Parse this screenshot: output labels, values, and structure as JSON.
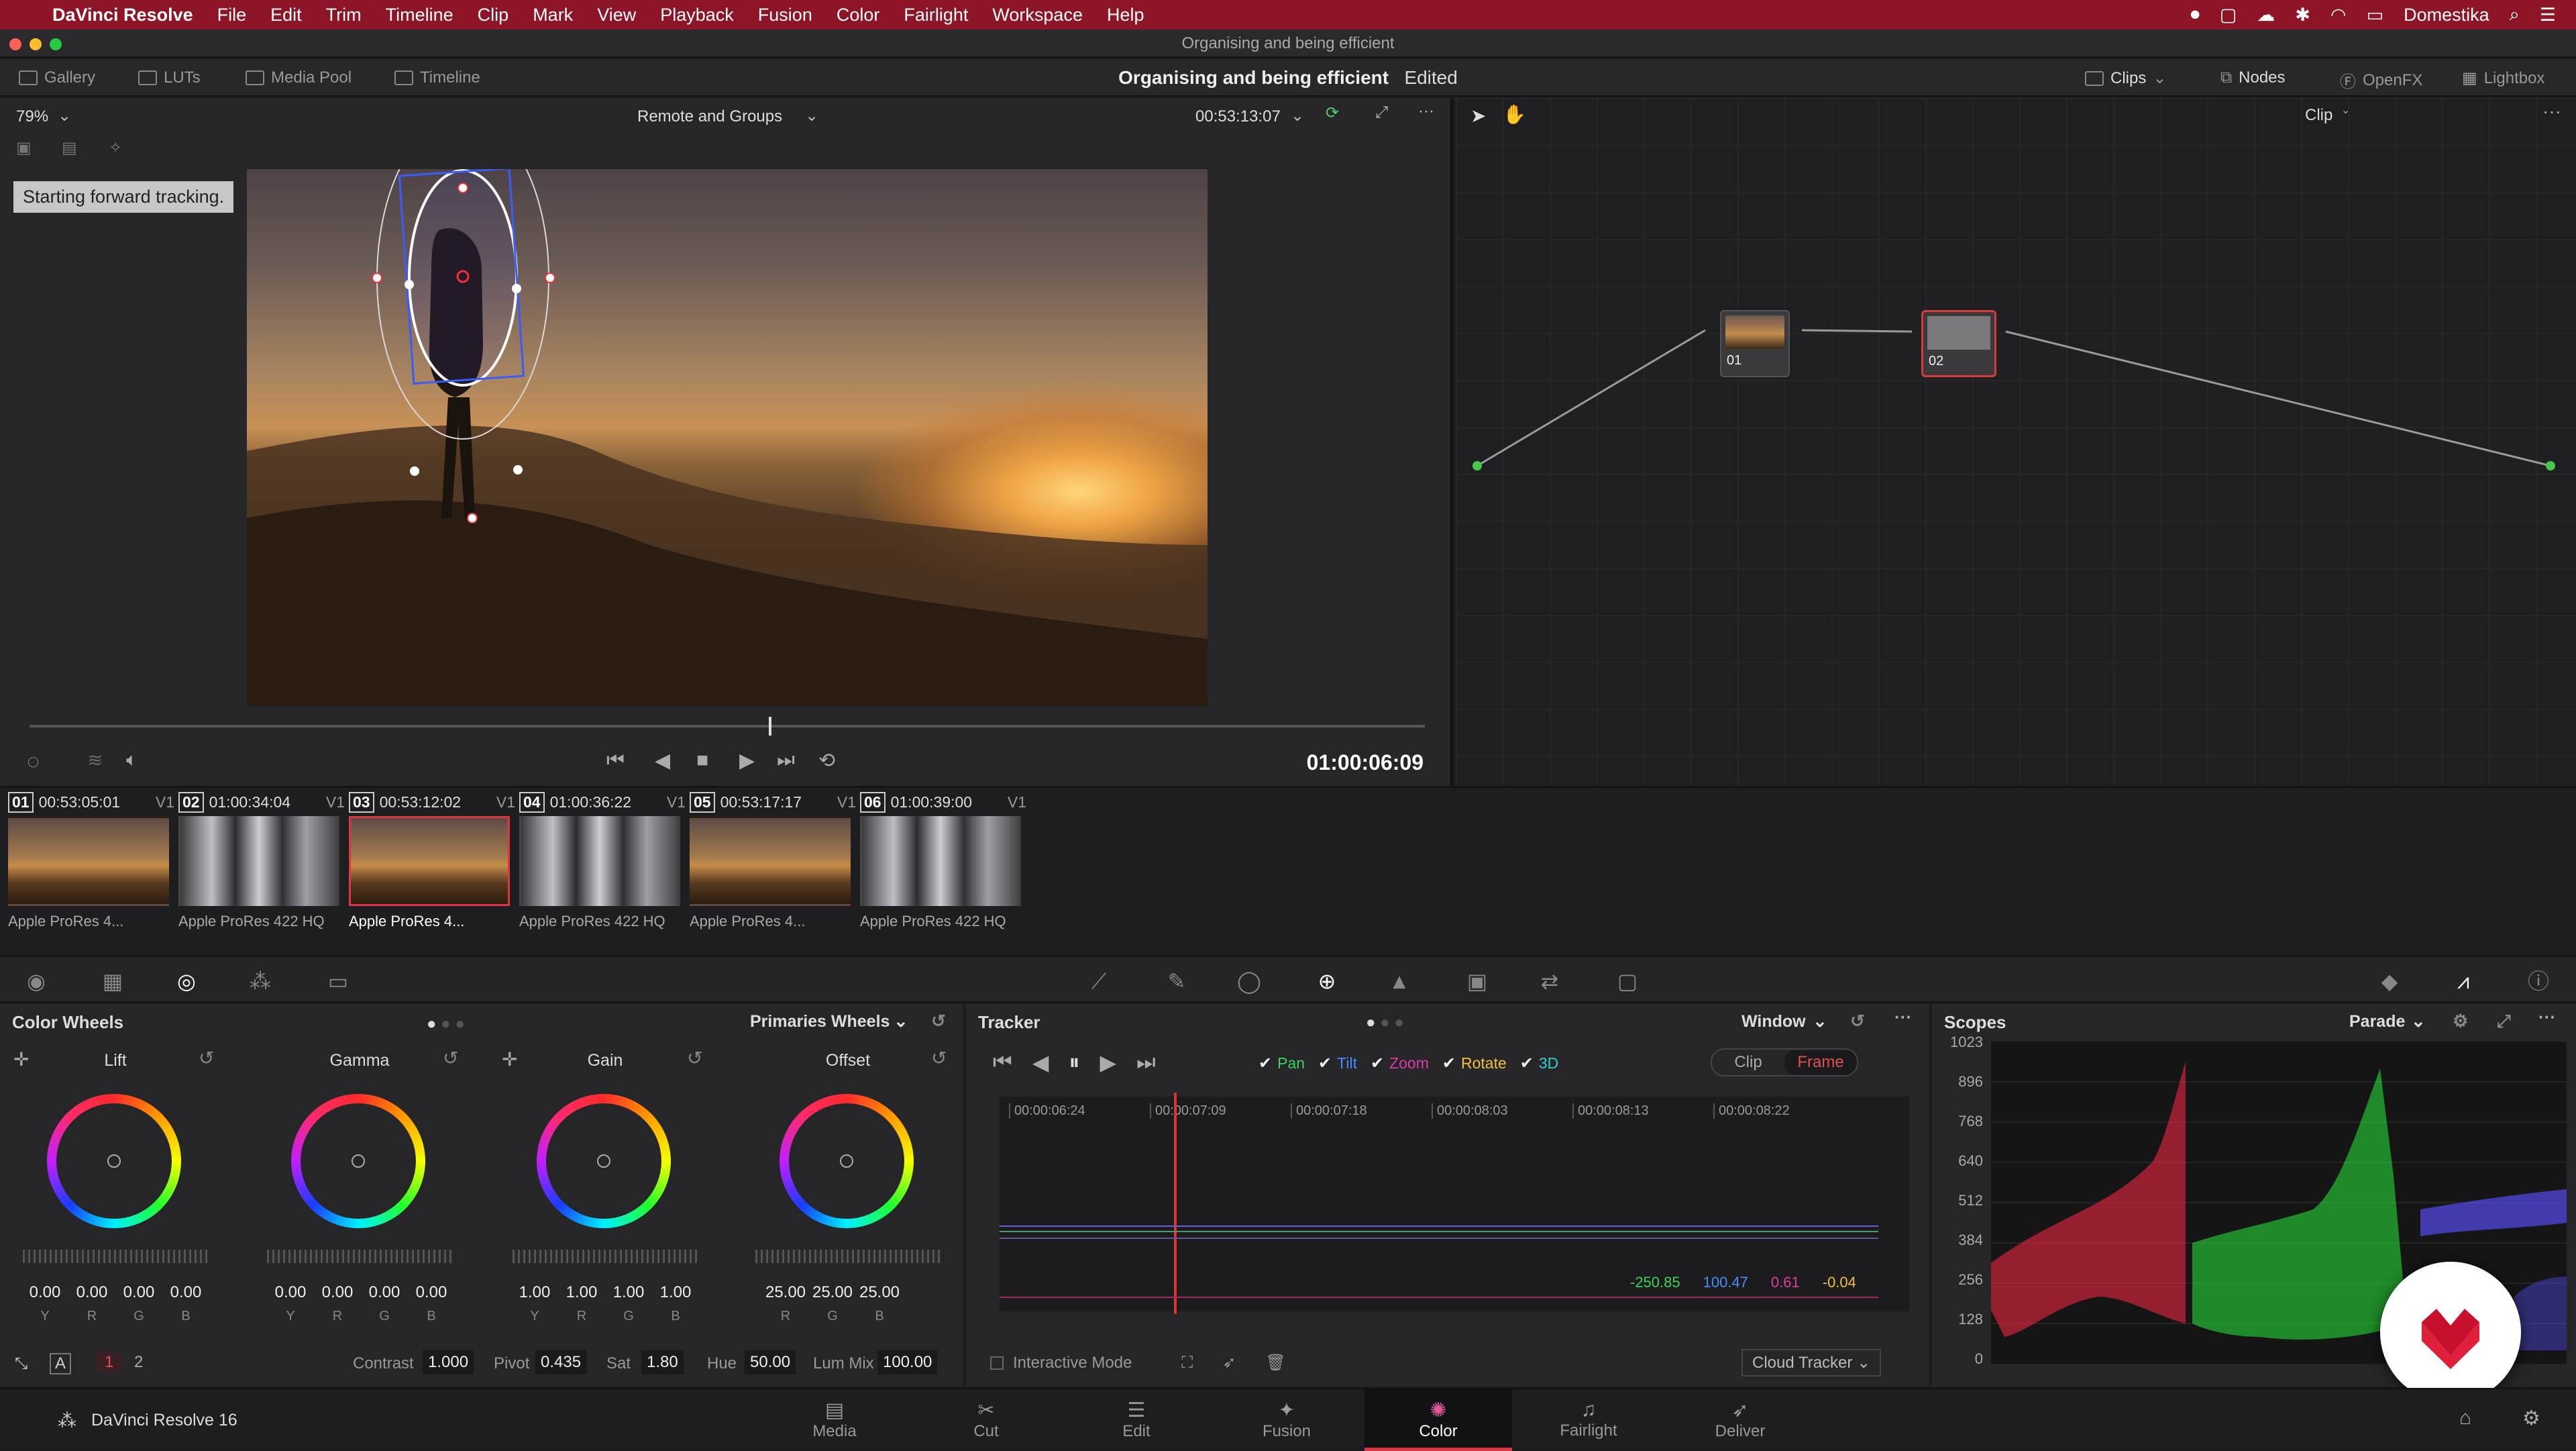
{
  "menubar": {
    "app": "DaVinci Resolve",
    "items": [
      "File",
      "Edit",
      "Trim",
      "Timeline",
      "Clip",
      "Mark",
      "View",
      "Playback",
      "Fusion",
      "Color",
      "Fairlight",
      "Workspace",
      "Help"
    ],
    "user": "Domestika"
  },
  "window_title": "Organising and being efficient",
  "toolbar": {
    "gallery": "Gallery",
    "luts": "LUTs",
    "media_pool": "Media Pool",
    "timeline": "Timeline",
    "project_title": "Organising and being efficient",
    "edited": "Edited",
    "clips": "Clips",
    "nodes": "Nodes",
    "openfx": "OpenFX",
    "lightbox": "Lightbox"
  },
  "viewer": {
    "zoom": "79%",
    "timeline_name": "Remote and Groups",
    "source_tc": "00:53:13:07",
    "status": "Starting forward tracking.",
    "timecode": "01:00:06:09",
    "scrub_fraction": 0.53
  },
  "nodes": {
    "clip_mode": "Clip",
    "node1_label": "01",
    "node2_label": "02"
  },
  "clips": [
    {
      "num": "01",
      "tc": "00:53:05:01",
      "track": "V1",
      "codec": "Apple ProRes 4...",
      "kind": "a",
      "selected": false
    },
    {
      "num": "02",
      "tc": "01:00:34:04",
      "track": "V1",
      "codec": "Apple ProRes 422 HQ",
      "kind": "b",
      "selected": false
    },
    {
      "num": "03",
      "tc": "00:53:12:02",
      "track": "V1",
      "codec": "Apple ProRes 4...",
      "kind": "a",
      "selected": true
    },
    {
      "num": "04",
      "tc": "01:00:36:22",
      "track": "V1",
      "codec": "Apple ProRes 422 HQ",
      "kind": "b",
      "selected": false
    },
    {
      "num": "05",
      "tc": "00:53:17:17",
      "track": "V1",
      "codec": "Apple ProRes 4...",
      "kind": "a",
      "selected": false
    },
    {
      "num": "06",
      "tc": "01:00:39:00",
      "track": "V1",
      "codec": "Apple ProRes 422 HQ",
      "kind": "b",
      "selected": false
    }
  ],
  "color_wheels": {
    "title": "Color Wheels",
    "mode": "Primaries Wheels",
    "wheels": [
      {
        "name": "Lift",
        "values": [
          "0.00",
          "0.00",
          "0.00",
          "0.00"
        ],
        "labels": [
          "Y",
          "R",
          "G",
          "B"
        ]
      },
      {
        "name": "Gamma",
        "values": [
          "0.00",
          "0.00",
          "0.00",
          "0.00"
        ],
        "labels": [
          "Y",
          "R",
          "G",
          "B"
        ]
      },
      {
        "name": "Gain",
        "values": [
          "1.00",
          "1.00",
          "1.00",
          "1.00"
        ],
        "labels": [
          "Y",
          "R",
          "G",
          "B"
        ]
      },
      {
        "name": "Offset",
        "values": [
          "25.00",
          "25.00",
          "25.00"
        ],
        "labels": [
          "R",
          "G",
          "B"
        ]
      }
    ],
    "page1": "1",
    "page2": "2",
    "contrast_label": "Contrast",
    "contrast": "1.000",
    "pivot_label": "Pivot",
    "pivot": "0.435",
    "sat_label": "Sat",
    "sat": "1.80",
    "hue_label": "Hue",
    "hue": "50.00",
    "lummix_label": "Lum Mix",
    "lummix": "100.00"
  },
  "tracker": {
    "title": "Tracker",
    "mode": "Window",
    "options": [
      "Pan",
      "Tilt",
      "Zoom",
      "Rotate",
      "3D"
    ],
    "option_colors": [
      "#3bd45b",
      "#4a8cff",
      "#e03aa8",
      "#f0c040",
      "#30d0d0"
    ],
    "clip_btn": "Clip",
    "frame_btn": "Frame",
    "ruler": [
      "00:00:06:24",
      "00:00:07:09",
      "00:00:07:18",
      "00:00:08:03",
      "00:00:08:13",
      "00:00:08:22"
    ],
    "readouts": [
      "-250.85",
      "100.47",
      "0.61",
      "-0.04"
    ],
    "readout_colors": [
      "#3bd45b",
      "#4a8cff",
      "#e03aa8",
      "#f0c040"
    ],
    "interactive_mode": "Interactive Mode",
    "cloud_tracker": "Cloud Tracker"
  },
  "scopes": {
    "title": "Scopes",
    "mode": "Parade",
    "scale": [
      "1023",
      "896",
      "768",
      "640",
      "512",
      "384",
      "256",
      "128",
      "0"
    ]
  },
  "bottom": {
    "app_name": "DaVinci Resolve 16",
    "nav": [
      "Media",
      "Cut",
      "Edit",
      "Fusion",
      "Color",
      "Fairlight",
      "Deliver"
    ],
    "active": "Color"
  }
}
